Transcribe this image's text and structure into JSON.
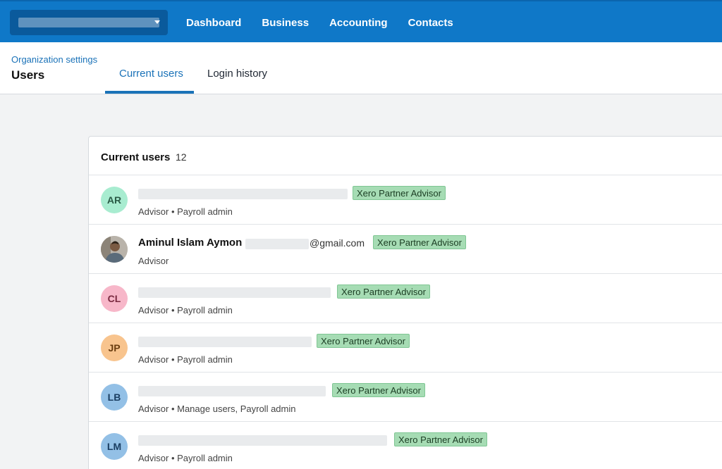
{
  "nav": {
    "links": [
      "Dashboard",
      "Business",
      "Accounting",
      "Contacts"
    ]
  },
  "header": {
    "breadcrumb": "Organization settings",
    "title": "Users",
    "tabs": [
      "Current users",
      "Login history"
    ]
  },
  "panel": {
    "title": "Current users",
    "count": "12"
  },
  "users": [
    {
      "initials": "AR",
      "name": "",
      "email_suffix": "",
      "badge": "Xero Partner Advisor",
      "roles": "Advisor • Payroll admin",
      "avatar_bg": "#a8ecd0",
      "avatar_fg": "#2a5a46"
    },
    {
      "initials": "",
      "name": "Aminul Islam Aymon",
      "email_suffix": "@gmail.com",
      "badge": "Xero Partner Advisor",
      "roles": "Advisor",
      "avatar_bg": "#8a7a6a",
      "avatar_fg": "#ffffff"
    },
    {
      "initials": "CL",
      "name": "",
      "email_suffix": "",
      "badge": "Xero Partner Advisor",
      "roles": "Advisor • Payroll admin",
      "avatar_bg": "#f7b7c9",
      "avatar_fg": "#7a2a40"
    },
    {
      "initials": "JP",
      "name": "",
      "email_suffix": "",
      "badge": "Xero Partner Advisor",
      "roles": "Advisor • Payroll admin",
      "avatar_bg": "#f8c48e",
      "avatar_fg": "#6a3d10"
    },
    {
      "initials": "LB",
      "name": "",
      "email_suffix": "",
      "badge": "Xero Partner Advisor",
      "roles": "Advisor • Manage users, Payroll admin",
      "avatar_bg": "#93c0e6",
      "avatar_fg": "#1b3e62"
    },
    {
      "initials": "LM",
      "name": "",
      "email_suffix": "",
      "badge": "Xero Partner Advisor",
      "roles": "Advisor • Payroll admin",
      "avatar_bg": "#93c0e6",
      "avatar_fg": "#1b3e62"
    }
  ]
}
